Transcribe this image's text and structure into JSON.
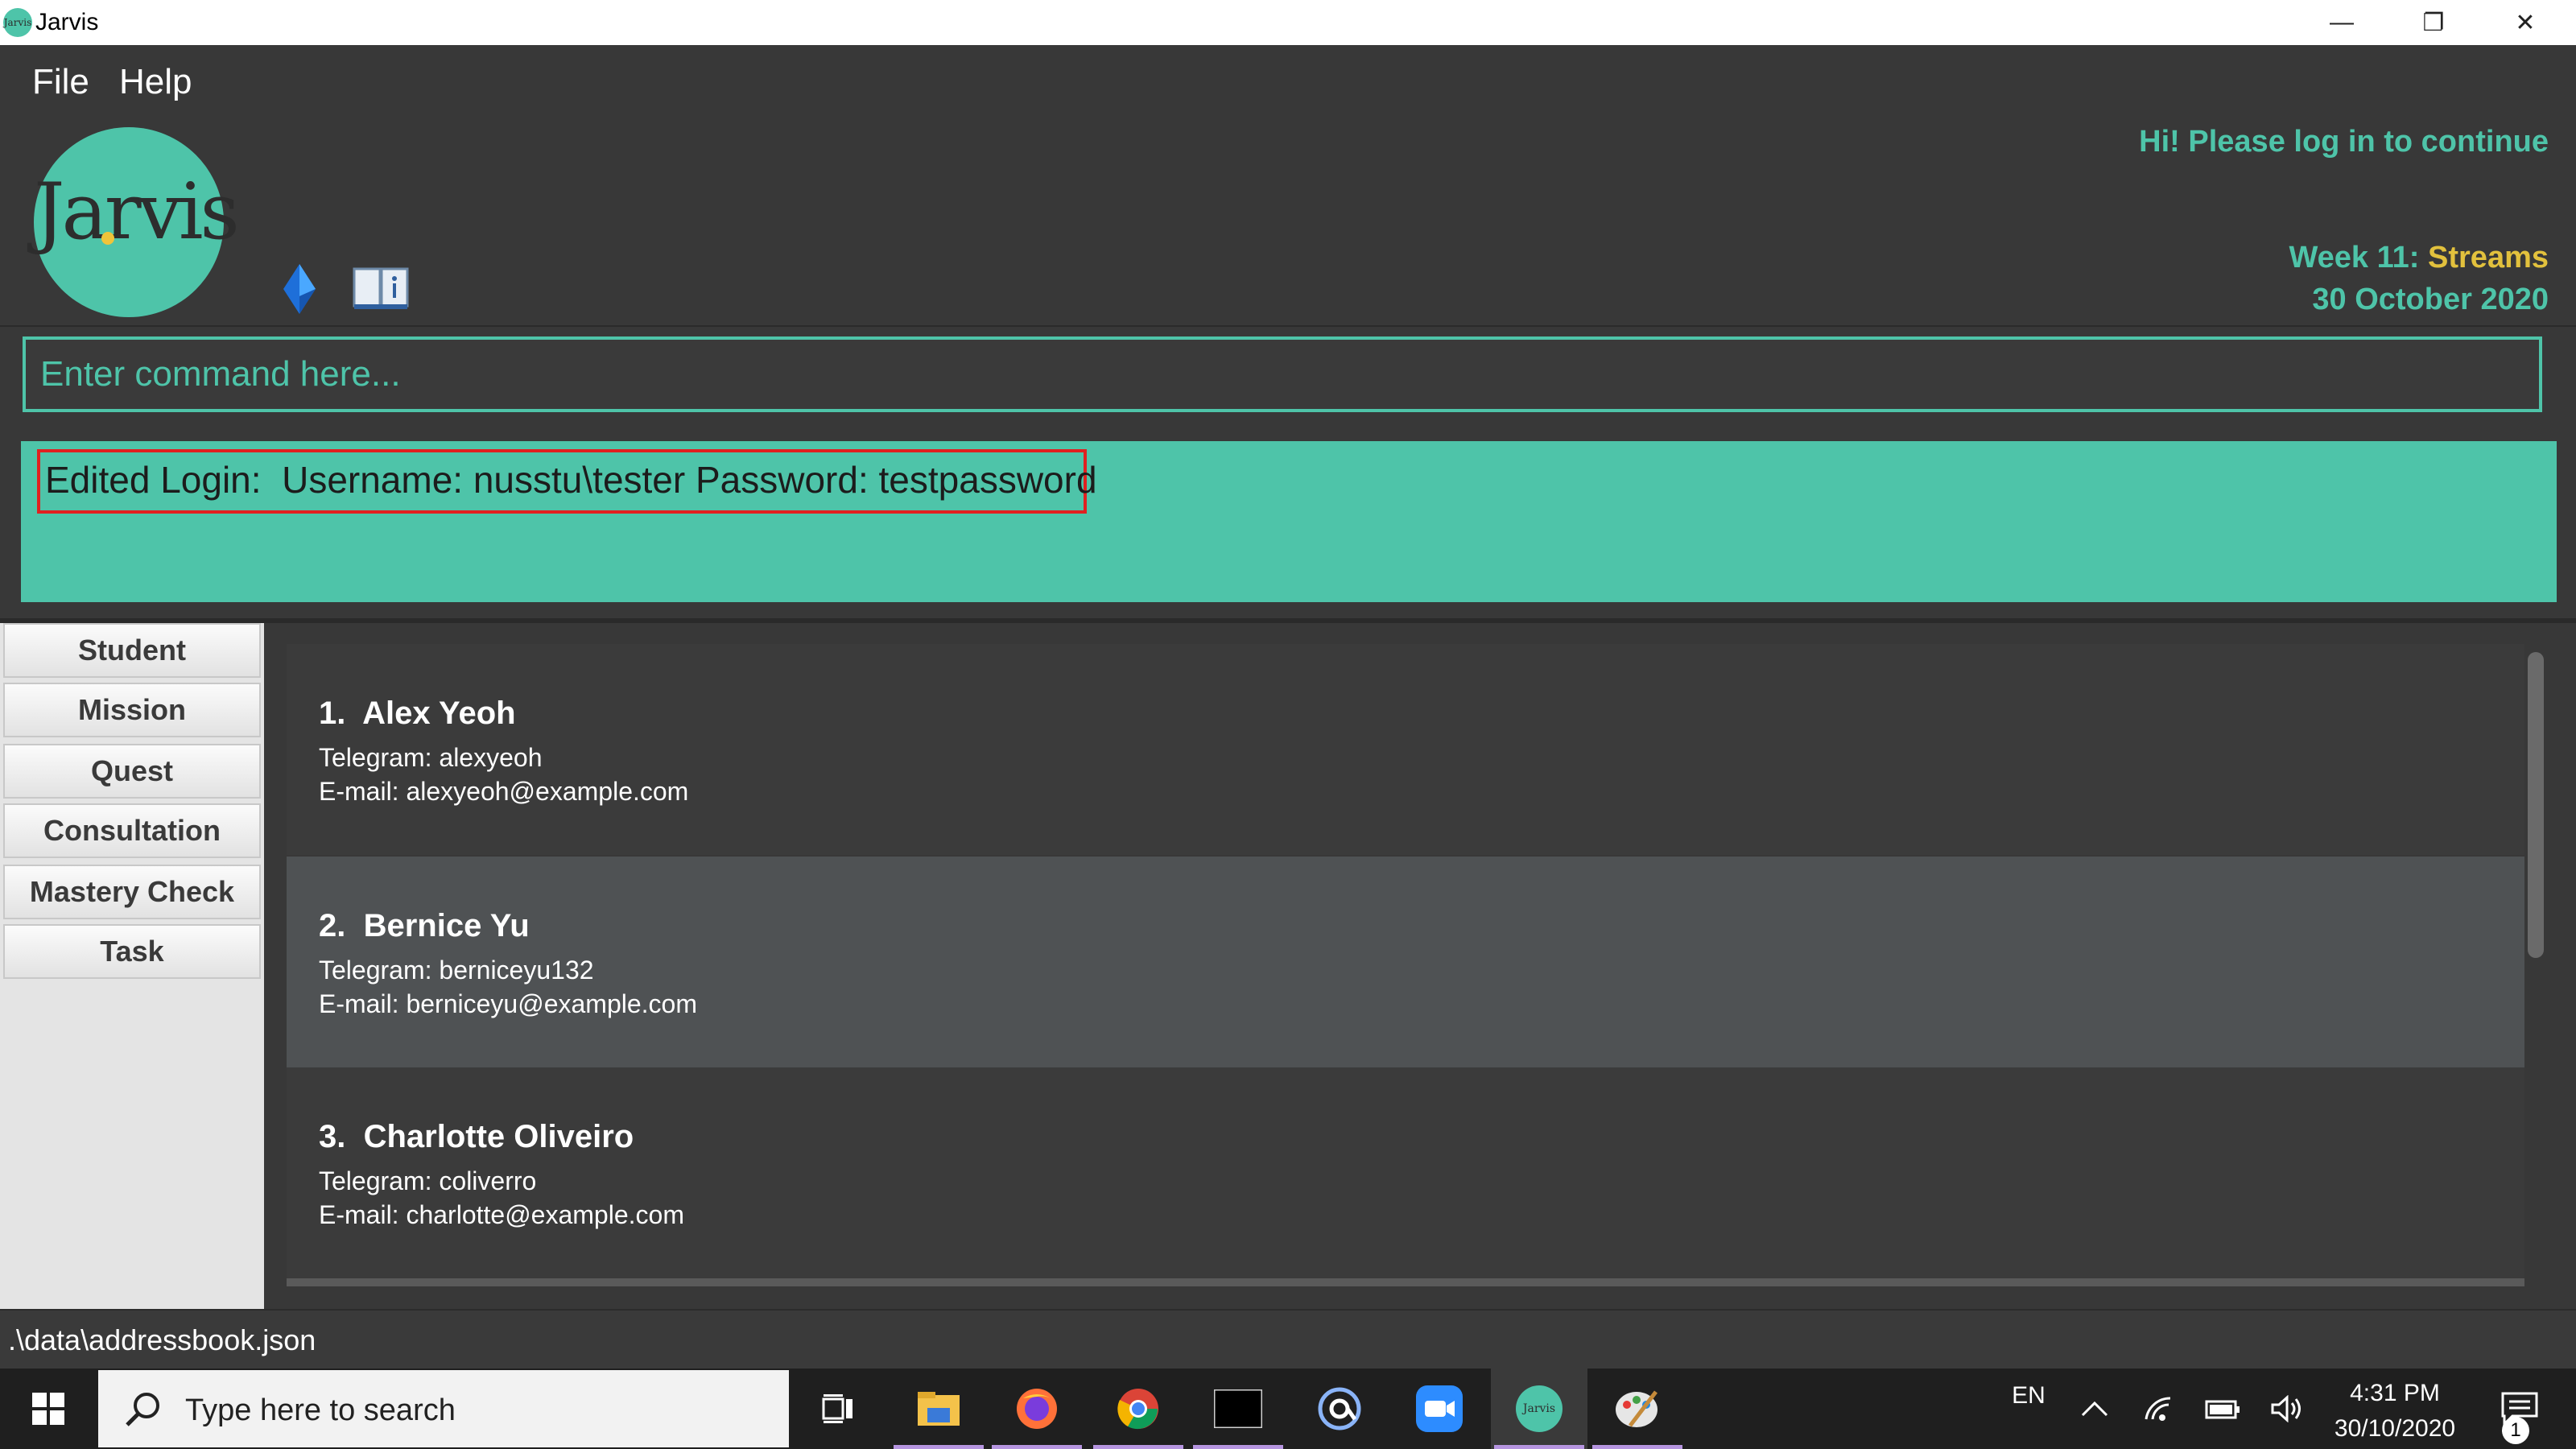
{
  "window": {
    "icon_text": "Jarvis",
    "title": "Jarvis",
    "minimize": "—",
    "restore": "❐",
    "close": "✕"
  },
  "menu": {
    "file": "File",
    "help": "Help"
  },
  "header": {
    "logo_text": "Jarvis",
    "login_message": "Hi! Please log in to continue",
    "week_label": "Week 11: ",
    "week_topic": "Streams",
    "date": "30 October 2020"
  },
  "command": {
    "placeholder": "Enter command here..."
  },
  "result": {
    "text": "Edited Login:  Username: nusstu\\tester Password: testpassword"
  },
  "sidebar": {
    "items": [
      {
        "label": "Student"
      },
      {
        "label": "Mission"
      },
      {
        "label": "Quest"
      },
      {
        "label": "Consultation"
      },
      {
        "label": "Mastery Check"
      },
      {
        "label": "Task"
      }
    ]
  },
  "students": [
    {
      "name": "1.  Alex Yeoh",
      "telegram": "Telegram: alexyeoh",
      "email": "E-mail: alexyeoh@example.com"
    },
    {
      "name": "2.  Bernice Yu",
      "telegram": "Telegram: berniceyu132",
      "email": "E-mail: berniceyu@example.com"
    },
    {
      "name": "3.  Charlotte Oliveiro",
      "telegram": "Telegram: coliverro",
      "email": "E-mail: charlotte@example.com"
    }
  ],
  "status": {
    "path": ".\\data\\addressbook.json"
  },
  "taskbar": {
    "search_placeholder": "Type here to search",
    "language": "EN",
    "time": "4:31 PM",
    "date": "30/10/2020",
    "notifications": "1",
    "jarvis_icon_text": "Jarvis"
  },
  "colors": {
    "accent": "#4ec4a9",
    "topic": "#e2c13d",
    "highlight_border": "#e02020",
    "background": "#383838",
    "selected_card": "#4f5254"
  }
}
